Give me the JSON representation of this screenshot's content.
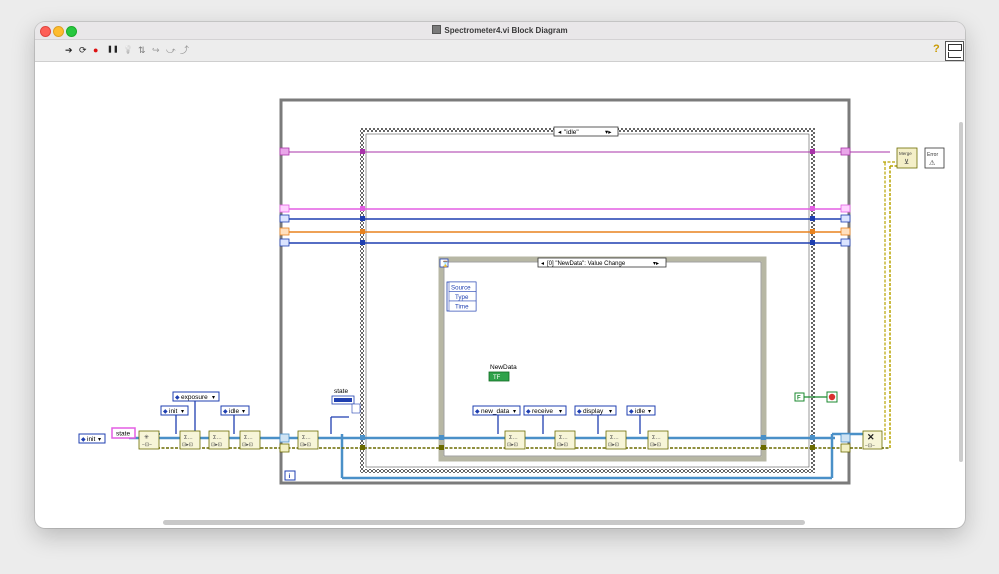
{
  "window": {
    "title": "Spectrometer4.vi Block Diagram"
  },
  "toolbar": {
    "tools": [
      {
        "name": "run-arrow-icon",
        "glyph": "➔"
      },
      {
        "name": "run-continuously-icon",
        "glyph": "⟳"
      },
      {
        "name": "abort-icon",
        "glyph": "●"
      },
      {
        "name": "pause-icon",
        "glyph": "❚❚"
      },
      {
        "name": "highlight-execution-icon",
        "glyph": "💡"
      },
      {
        "name": "retain-wire-values-icon",
        "glyph": "⇅"
      },
      {
        "name": "step-into-icon",
        "glyph": "↪"
      },
      {
        "name": "step-over-icon",
        "glyph": "⤻"
      },
      {
        "name": "step-out-icon",
        "glyph": "⤴"
      }
    ],
    "help_glyph": "?"
  },
  "diagram": {
    "case_selector": "\"idle\"",
    "event_selector": "[0] \"NewData\": Value Change",
    "event_data": [
      "Source",
      "Type",
      "Time"
    ],
    "newdata_label": "NewData",
    "newdata_value": "TF",
    "state_label": "state",
    "state_indicator": "state",
    "loop_index": "i",
    "init_enum": "init",
    "exposure_enum": "exposure",
    "init_enum2": "init",
    "idle_enum": "idle",
    "event_enums": [
      "new_data",
      "receive",
      "display",
      "idle"
    ],
    "false_const": "F",
    "merge_error": "Merge\nErrors",
    "error_handler": "Error"
  },
  "colors": {
    "cluster_wire": "#4a90c8",
    "error_wire": "#6b6b00",
    "pink_wire": "#cc44cc",
    "purple_wire": "#aa33aa",
    "blue_wire": "#1f3fb0",
    "orange_wire": "#e8821e",
    "bool_wire": "#1b8a2f"
  }
}
